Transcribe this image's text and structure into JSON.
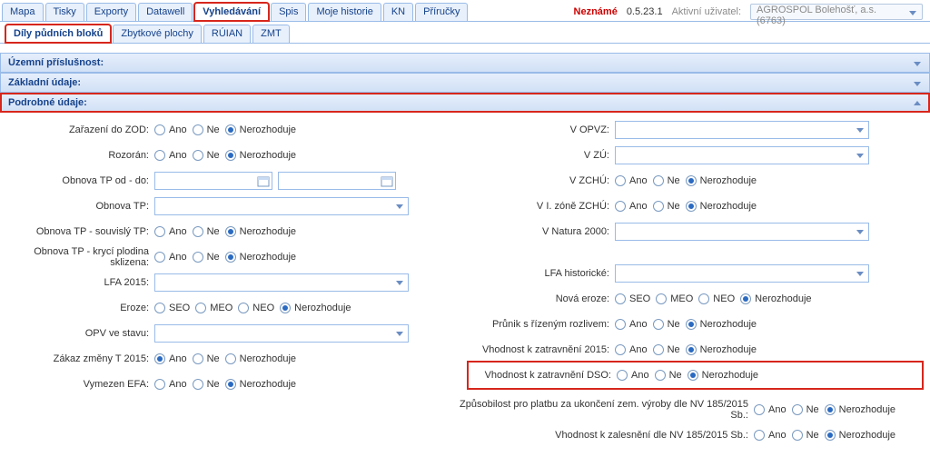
{
  "topTabs": {
    "items": [
      "Mapa",
      "Tisky",
      "Exporty",
      "Datawell",
      "Vyhledávání",
      "Spis",
      "Moje historie",
      "KN",
      "Příručky"
    ],
    "activeIndex": 4
  },
  "topRight": {
    "status": "Neznámé",
    "version": "0.5.23.1",
    "activeUserLabel": "Aktivní uživatel:",
    "userValue": "AGROSPOL Bolehošť, a.s. (6763)"
  },
  "subTabs": {
    "items": [
      "Díly půdních bloků",
      "Zbytkové plochy",
      "RÚIAN",
      "ZMT"
    ],
    "activeIndex": 0
  },
  "sections": {
    "uzemni": "Územní příslušnost:",
    "zakladni": "Základní údaje:",
    "podrobne": "Podrobné údaje:"
  },
  "radios": {
    "ano": "Ano",
    "ne": "Ne",
    "neroz": "Nerozhoduje",
    "seo": "SEO",
    "meo": "MEO",
    "neo": "NEO"
  },
  "left": {
    "zarazeniZOD": "Zařazení do ZOD:",
    "rozoran": "Rozorán:",
    "obnovaTPOdDo": "Obnova TP od - do:",
    "obnovaTP": "Obnova TP:",
    "obnovaTPSouvisly": "Obnova TP - souvislý TP:",
    "obnovaTPKryci": "Obnova TP - krycí plodina sklizena:",
    "lfa2015": "LFA 2015:",
    "eroze": "Eroze:",
    "opvVeStavu": "OPV ve stavu:",
    "zakazZmenyT2015": "Zákaz změny T 2015:",
    "vymezenEFA": "Vymezen EFA:"
  },
  "right": {
    "vOPVZ": "V OPVZ:",
    "vZU": "V ZÚ:",
    "vZCHU": "V ZCHÚ:",
    "vIZoneZCHU": "V I. zóně ZCHÚ:",
    "vNatura2000": "V Natura 2000:",
    "lfaHistoricke": "LFA historické:",
    "novaEroze": "Nová eroze:",
    "prunikRozliv": "Průnik s řízeným rozlivem:",
    "vhodnost2015": "Vhodnost k zatravnění 2015:",
    "vhodnostDSO": "Vhodnost k zatravnění DSO:"
  },
  "bottom": {
    "zpusobilost": "Způsobilost pro platbu za ukončení zem. výroby dle NV 185/2015 Sb.:",
    "zalesneni": "Vhodnost k zalesnění dle NV 185/2015 Sb.:"
  }
}
